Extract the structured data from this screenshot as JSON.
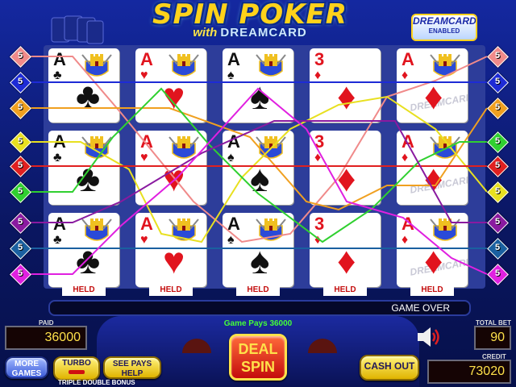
{
  "game": {
    "title": "SPIN POKER",
    "subtitle_with": "with",
    "subtitle_brand": "DREAMCARD",
    "badge_line1": "DREAMCARD",
    "badge_line2": "ENABLED",
    "variant": "TRIPLE DOUBLE BONUS"
  },
  "paylines": {
    "left": [
      {
        "num": "5",
        "color": "#f08a8a"
      },
      {
        "num": "5",
        "color": "#1d2bd6"
      },
      {
        "num": "5",
        "color": "#f0a020"
      },
      {
        "num": "5",
        "color": "#e8e020"
      },
      {
        "num": "5",
        "color": "#e02020"
      },
      {
        "num": "5",
        "color": "#30d030"
      },
      {
        "num": "5",
        "color": "#8a1aa0"
      },
      {
        "num": "5",
        "color": "#1a60a0"
      },
      {
        "num": "5",
        "color": "#e020e0"
      }
    ],
    "right": [
      {
        "num": "5",
        "color": "#f08a8a"
      },
      {
        "num": "5",
        "color": "#1d2bd6"
      },
      {
        "num": "5",
        "color": "#f0a020"
      },
      {
        "num": "5",
        "color": "#30d030"
      },
      {
        "num": "5",
        "color": "#e02020"
      },
      {
        "num": "5",
        "color": "#e8e020"
      },
      {
        "num": "5",
        "color": "#8a1aa0"
      },
      {
        "num": "5",
        "color": "#1a60a0"
      },
      {
        "num": "5",
        "color": "#e020e0"
      }
    ]
  },
  "columns": [
    {
      "rank": "A",
      "suit": "♣",
      "color": "black",
      "held": "HELD",
      "dream": false
    },
    {
      "rank": "A",
      "suit": "♥",
      "color": "red",
      "held": "HELD",
      "dream": false
    },
    {
      "rank": "A",
      "suit": "♠",
      "color": "black",
      "held": "HELD",
      "dream": false
    },
    {
      "rank": "3",
      "suit": "♦",
      "color": "red",
      "held": "HELD",
      "dream": false
    },
    {
      "rank": "A",
      "suit": "♦",
      "color": "red",
      "held": "HELD",
      "dream": true,
      "dream_text": "DREAMCARD"
    }
  ],
  "status": {
    "message": "GAME OVER",
    "game_pays": "Game Pays 36000"
  },
  "meters": {
    "paid_label": "PAID",
    "paid_value": "36000",
    "total_bet_label": "TOTAL BET",
    "total_bet_value": "90",
    "credit_label": "CREDIT",
    "credit_value": "73020"
  },
  "buttons": {
    "more_games": "MORE GAMES",
    "turbo": "TURBO",
    "see_pays": "SEE PAYS HELP",
    "deal_spin": "DEAL SPIN",
    "cash_out": "CASH OUT"
  }
}
